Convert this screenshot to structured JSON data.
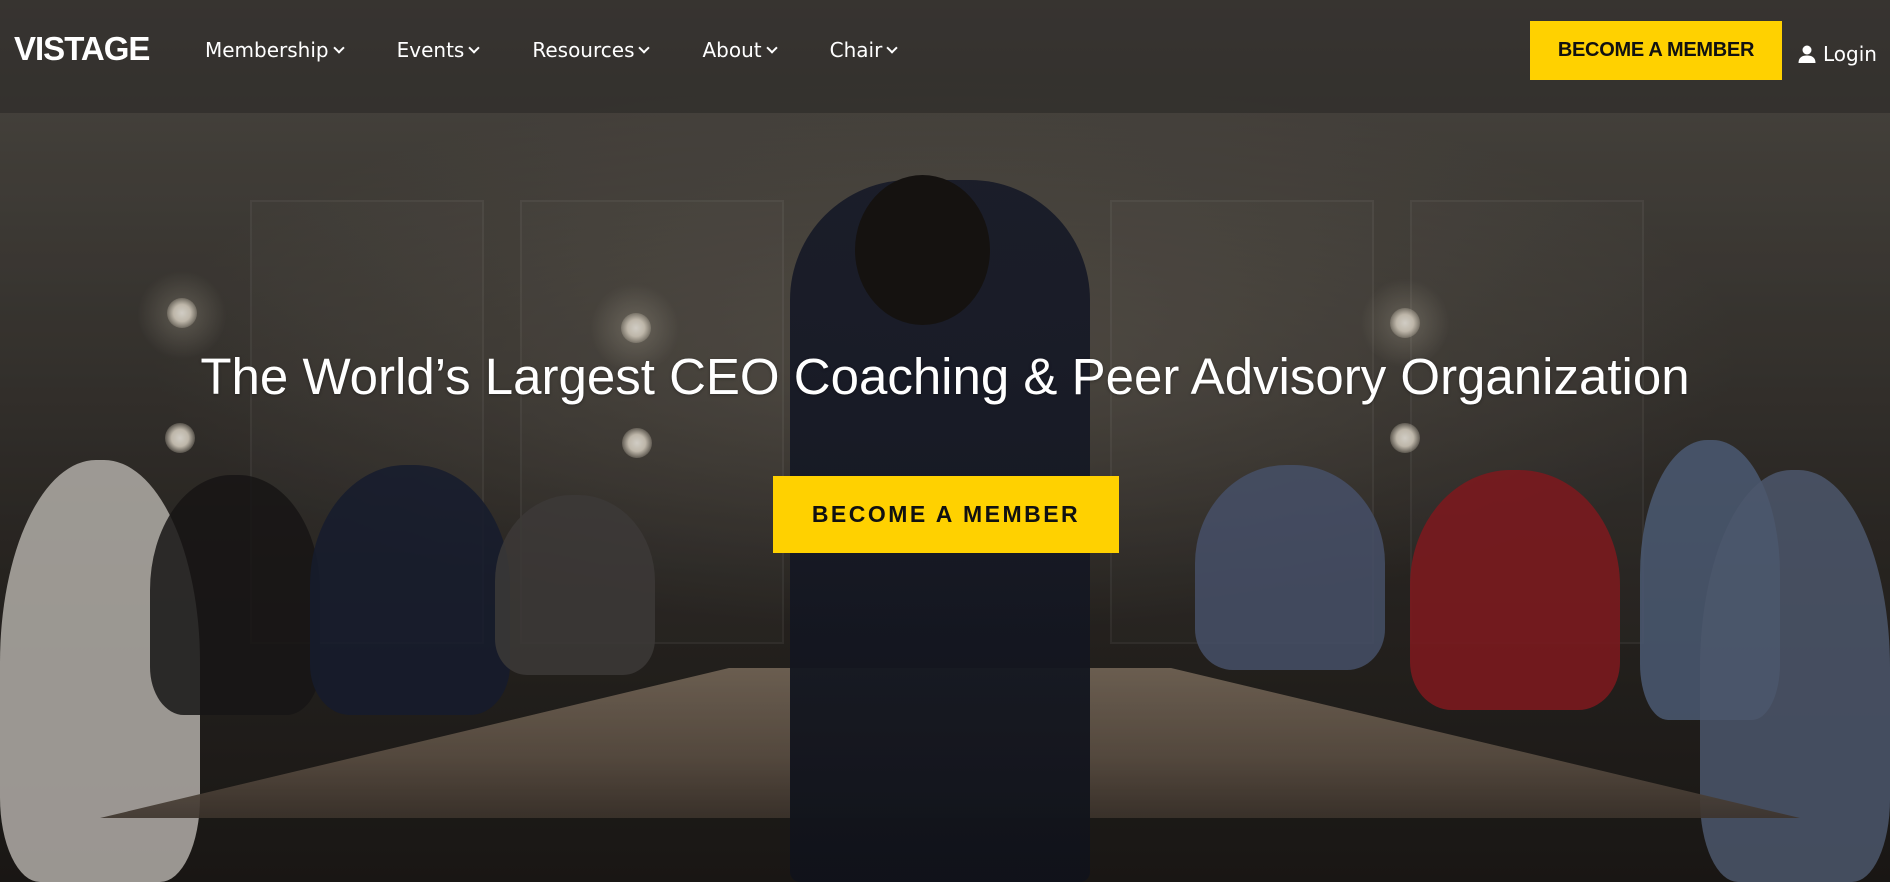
{
  "header": {
    "logo_text": "VISTAGE",
    "nav": [
      {
        "label": "Membership",
        "icon": "chevron-down-icon"
      },
      {
        "label": "Events",
        "icon": "chevron-down-icon"
      },
      {
        "label": "Resources",
        "icon": "chevron-down-icon"
      },
      {
        "label": "About",
        "icon": "chevron-down-icon"
      },
      {
        "label": "Chair",
        "icon": "chevron-down-icon"
      }
    ],
    "cta_label": "BECOME A MEMBER",
    "login_label": "Login",
    "login_icon": "user-icon"
  },
  "hero": {
    "title": "The World’s Largest CEO Coaching & Peer Advisory Organization",
    "cta_label": "BECOME A MEMBER",
    "background_image": "conference-room-photo"
  },
  "colors": {
    "accent": "#ffd100",
    "header_text": "#ffffff",
    "cta_text": "#111111"
  }
}
